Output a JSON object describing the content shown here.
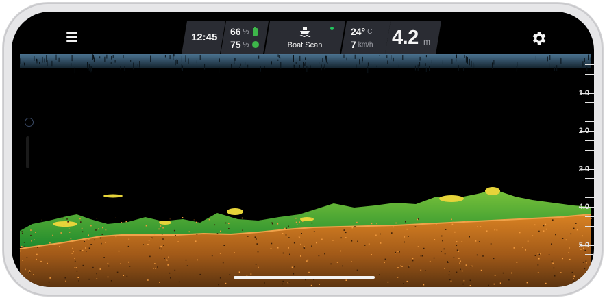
{
  "status_bar": {
    "time": "12:45",
    "battery_phone": {
      "value": "66",
      "unit": "%"
    },
    "battery_device": {
      "value": "75",
      "unit": "%"
    },
    "device_mode": "Boat Scan",
    "temperature": {
      "value": "24°",
      "unit": "C"
    },
    "speed": {
      "value": "7",
      "unit": "km/h"
    },
    "depth": {
      "value": "4.2",
      "unit": "m"
    }
  },
  "depth_scale": {
    "labels": [
      "1.0",
      "2.0",
      "3.0",
      "4.0",
      "5.0"
    ],
    "max_depth": 5.5
  },
  "icons": {
    "menu": "hamburger-menu-icon",
    "settings": "gear-icon",
    "boat": "boat-icon",
    "connection_status": "green-dot"
  },
  "colors": {
    "background": "#000000",
    "panel": "#2a2c33",
    "bottom_hard": "#d0771e",
    "bottom_weed": "#36a834",
    "fish_echo": "#e6d43a",
    "surface_noise": "#3d5f78",
    "status_ok": "#22c55e"
  }
}
